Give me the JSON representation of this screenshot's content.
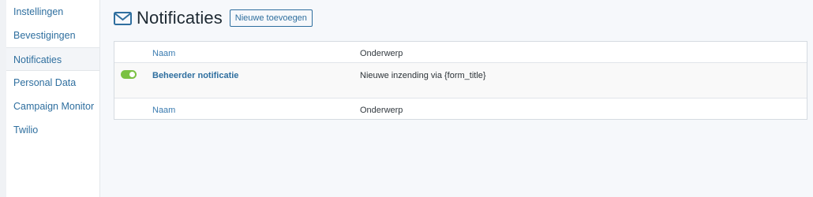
{
  "sidebar": {
    "items": [
      {
        "label": "Instellingen"
      },
      {
        "label": "Bevestigingen"
      },
      {
        "label": "Notificaties",
        "active": true
      },
      {
        "label": "Personal Data"
      },
      {
        "label": "Campaign Monitor"
      },
      {
        "label": "Twilio"
      }
    ]
  },
  "header": {
    "icon": "mail-icon",
    "title": "Notificaties",
    "add_button": "Nieuwe toevoegen"
  },
  "table": {
    "columns": {
      "name": "Naam",
      "subject": "Onderwerp"
    },
    "rows": [
      {
        "active": true,
        "name": "Beheerder notificatie",
        "subject": "Nieuwe inzending via {form_title}"
      }
    ],
    "footer": {
      "name": "Naam",
      "subject": "Onderwerp"
    }
  },
  "colors": {
    "accent": "#2f6f9f",
    "toggle_on": "#7ac142"
  }
}
